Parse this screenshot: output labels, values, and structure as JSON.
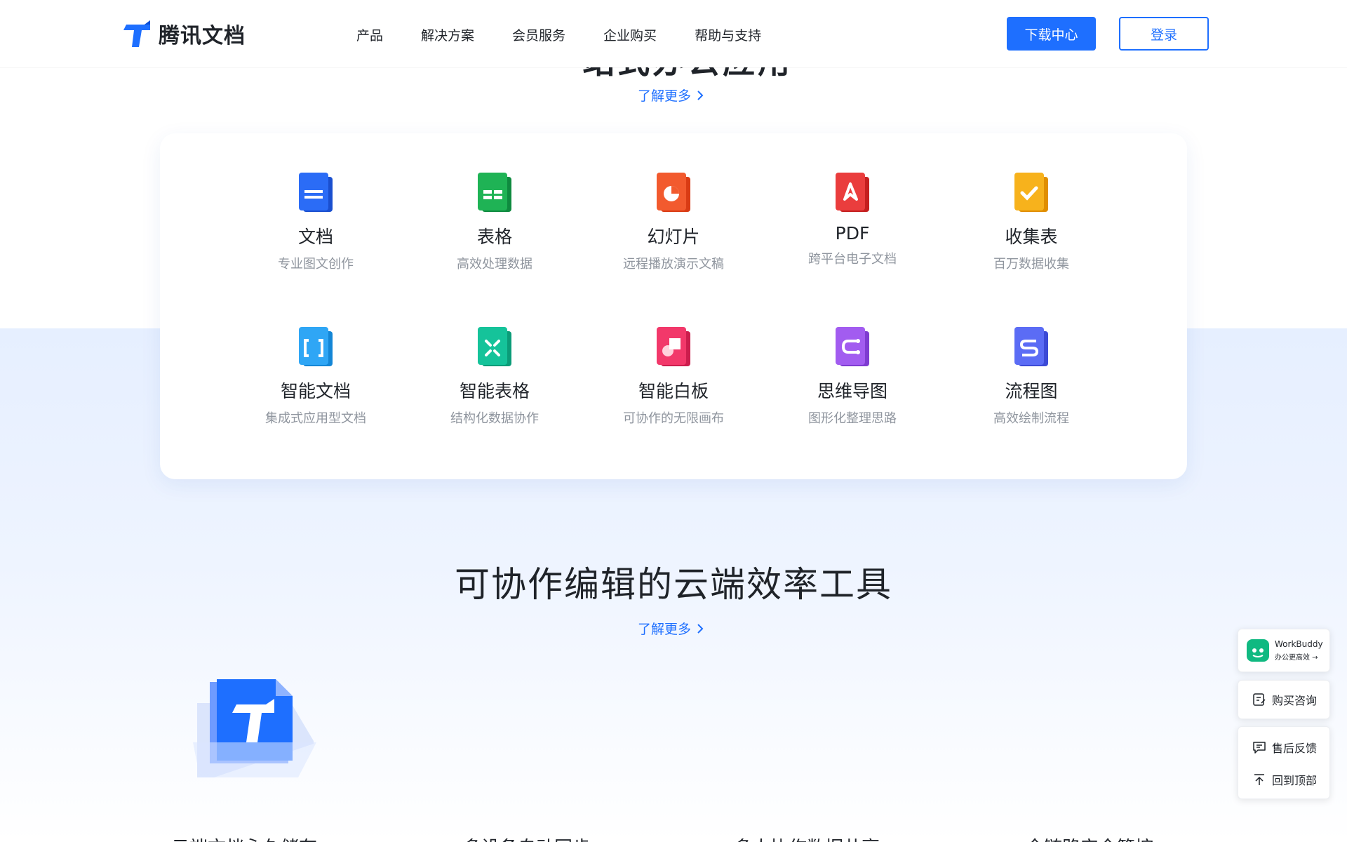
{
  "header": {
    "brand": "腾讯文档",
    "nav": [
      "产品",
      "解决方案",
      "会员服务",
      "企业购买",
      "帮助与支持"
    ],
    "download_label": "下载中心",
    "login_label": "登录"
  },
  "top_section": {
    "partial_heading": "一站式办公应用",
    "learn_more": "了解更多"
  },
  "products": [
    {
      "name": "文档",
      "desc": "专业图文创作",
      "icon": "doc-icon",
      "color": "#2b6cf6"
    },
    {
      "name": "表格",
      "desc": "高效处理数据",
      "icon": "sheet-icon",
      "color": "#1fb355"
    },
    {
      "name": "幻灯片",
      "desc": "远程播放演示文稿",
      "icon": "slide-icon",
      "color": "#f25a2e"
    },
    {
      "name": "PDF",
      "desc": "跨平台电子文档",
      "icon": "pdf-icon",
      "color": "#ea3d3d"
    },
    {
      "name": "收集表",
      "desc": "百万数据收集",
      "icon": "form-icon",
      "color": "#f7b21c"
    },
    {
      "name": "智能文档",
      "desc": "集成式应用型文档",
      "icon": "smart-doc-icon",
      "color": "#2fa6f5"
    },
    {
      "name": "智能表格",
      "desc": "结构化数据协作",
      "icon": "smart-sheet-icon",
      "color": "#15c39a"
    },
    {
      "name": "智能白板",
      "desc": "可协作的无限画布",
      "icon": "whiteboard-icon",
      "color": "#f2386a"
    },
    {
      "name": "思维导图",
      "desc": "图形化整理思路",
      "icon": "mindmap-icon",
      "color": "#a25cf0"
    },
    {
      "name": "流程图",
      "desc": "高效绘制流程",
      "icon": "flowchart-icon",
      "color": "#5b6cf5"
    }
  ],
  "collab_section": {
    "title": "可协作编辑的云端效率工具",
    "learn_more": "了解更多"
  },
  "features_partial": [
    "云端文档永久储存",
    "多设备自动同步",
    "多人协作数据共享",
    "全链路安全管控"
  ],
  "side_widgets": {
    "workbuddy_name": "WorkBuddy",
    "workbuddy_sub": "办公更高效 →",
    "buy_consult": "购买咨询",
    "after_sales": "售后反馈",
    "back_to_top": "回到顶部"
  },
  "colors": {
    "accent": "#1e6fff",
    "text": "#1f2329",
    "muted": "#8f959e",
    "band": "#e6efff"
  }
}
